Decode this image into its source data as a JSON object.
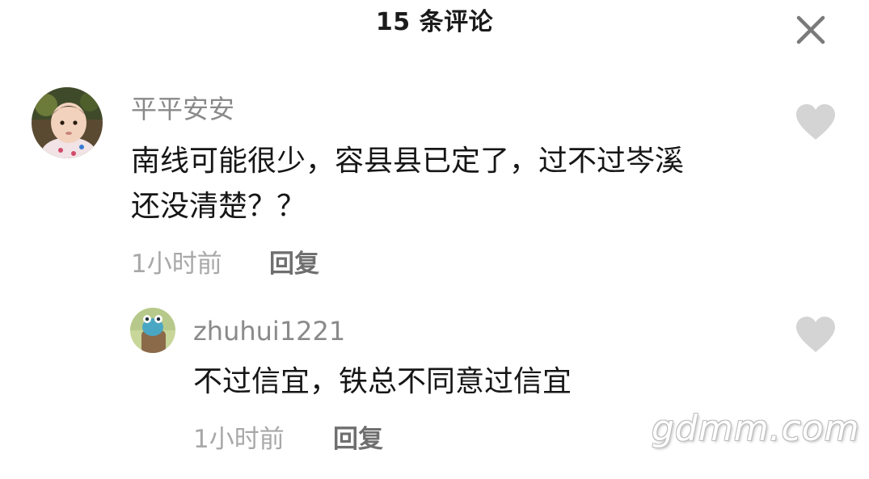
{
  "header": {
    "title": "15 条评论",
    "close_icon": "close-icon"
  },
  "comments": [
    {
      "username": "平平安安",
      "text_lines": [
        "南线可能很少，容县县已定了，过不过岑溪",
        "还没清楚？？"
      ],
      "time": "1小时前",
      "reply_label": "回复",
      "avatar_icon": "baby-photo-avatar",
      "like_icon": "heart-icon"
    },
    {
      "username": "zhuhui1221",
      "text_lines": [
        "不过信宜，铁总不同意过信宜"
      ],
      "time": "1小时前",
      "reply_label": "回复",
      "avatar_icon": "cartoon-avatar",
      "like_icon": "heart-icon"
    }
  ],
  "watermark": "gdmm.com",
  "colors": {
    "background": "#ffffff",
    "username": "#8a8a8a",
    "text": "#161616",
    "meta": "#a8a8a8",
    "heart": "#d4d4d4"
  }
}
